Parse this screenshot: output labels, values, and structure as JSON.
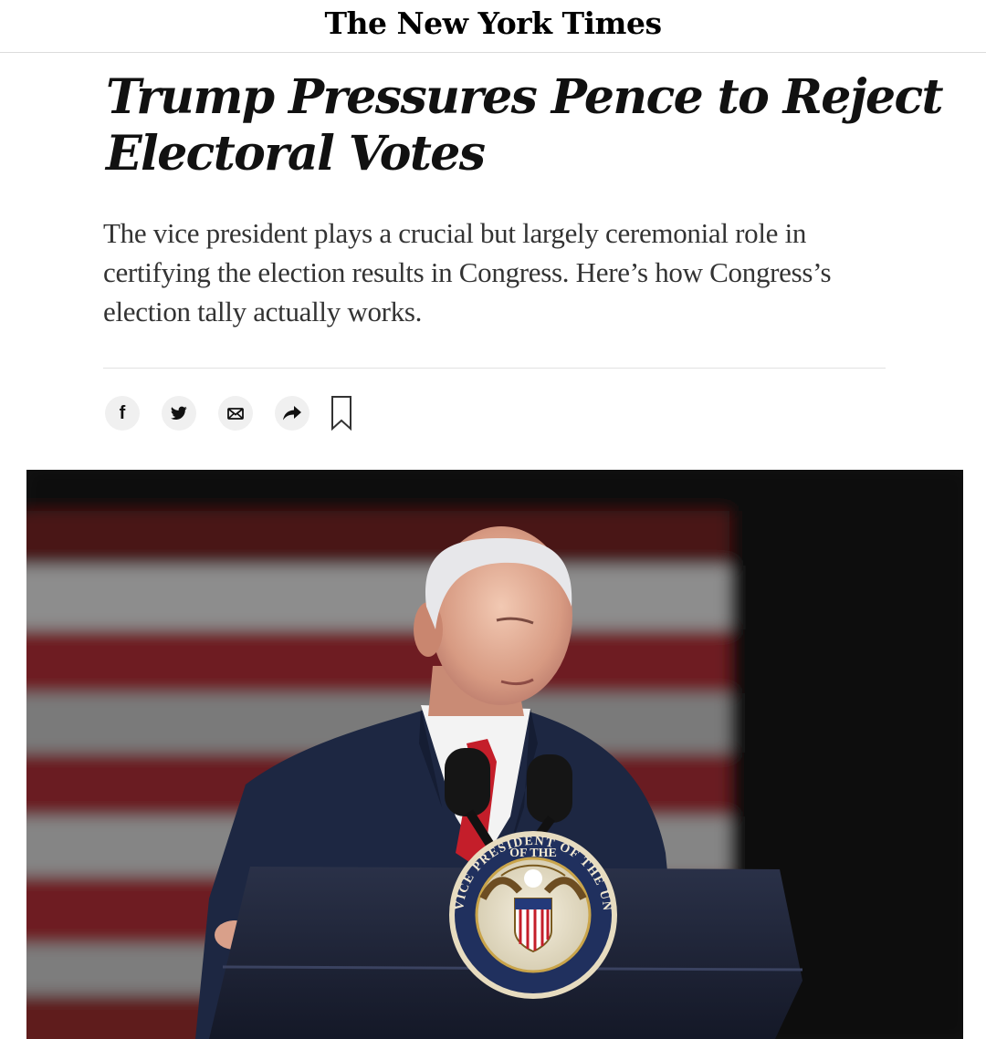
{
  "masthead": {
    "logo_text": "The New York Times"
  },
  "article": {
    "headline": "Trump Pressures Pence to Reject Electoral Votes",
    "summary": "The vice president plays a crucial but largely ceremonial role in certifying the election results in Congress. Here’s how Congress’s election tally actually works."
  },
  "share": {
    "facebook_glyph": "f",
    "buttons": [
      {
        "icon": "facebook-icon"
      },
      {
        "icon": "twitter-icon"
      },
      {
        "icon": "email-icon"
      },
      {
        "icon": "share-arrow-icon"
      },
      {
        "icon": "bookmark-icon"
      }
    ]
  },
  "photo": {
    "seal_text_top": "OF THE",
    "seal_text_ring": "VICE PRESIDENT OF THE UNITED STATES",
    "colors": {
      "flag_red": "#6e1f24",
      "flag_white": "#8a8a8a",
      "suit": "#1d2742",
      "tie": "#c41e2a",
      "podium": "#1c2236"
    }
  }
}
